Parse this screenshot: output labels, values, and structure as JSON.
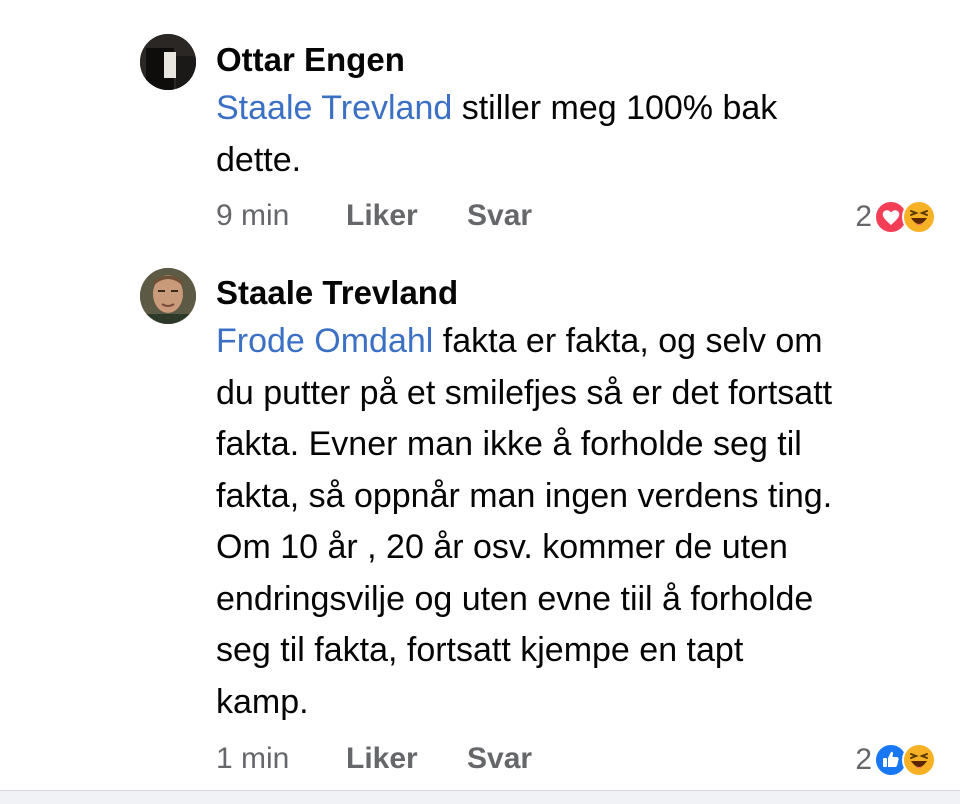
{
  "comments": [
    {
      "author": "Ottar Engen",
      "mention": "Staale Trevland",
      "body_lines": [
        " stiller meg 100% bak",
        "dette."
      ],
      "time": "9 min",
      "like_label": "Liker",
      "reply_label": "Svar",
      "reaction_count": "2",
      "reactions": [
        "heart-icon",
        "haha-icon"
      ]
    },
    {
      "author": "Staale Trevland",
      "mention": "Frode Omdahl",
      "body_lines": [
        " fakta er fakta, og selv om",
        "du putter på et smilefjes så er det fortsatt",
        "fakta. Evner man ikke å forholde seg til",
        "fakta, så oppnår man ingen verdens ting.",
        "Om 10 år , 20 år osv. kommer de uten",
        "endringsvilje og uten evne tiil å forholde",
        "seg til fakta, fortsatt kjempe en tapt",
        "kamp."
      ],
      "time": "1 min",
      "like_label": "Liker",
      "reply_label": "Svar",
      "reaction_count": "2",
      "reactions": [
        "like-icon",
        "haha-icon"
      ]
    }
  ],
  "colors": {
    "mention": "#3b70c4",
    "meta_text": "#65676b",
    "heart": "#f33e58",
    "like": "#1877f2",
    "haha": "#f7b125"
  }
}
